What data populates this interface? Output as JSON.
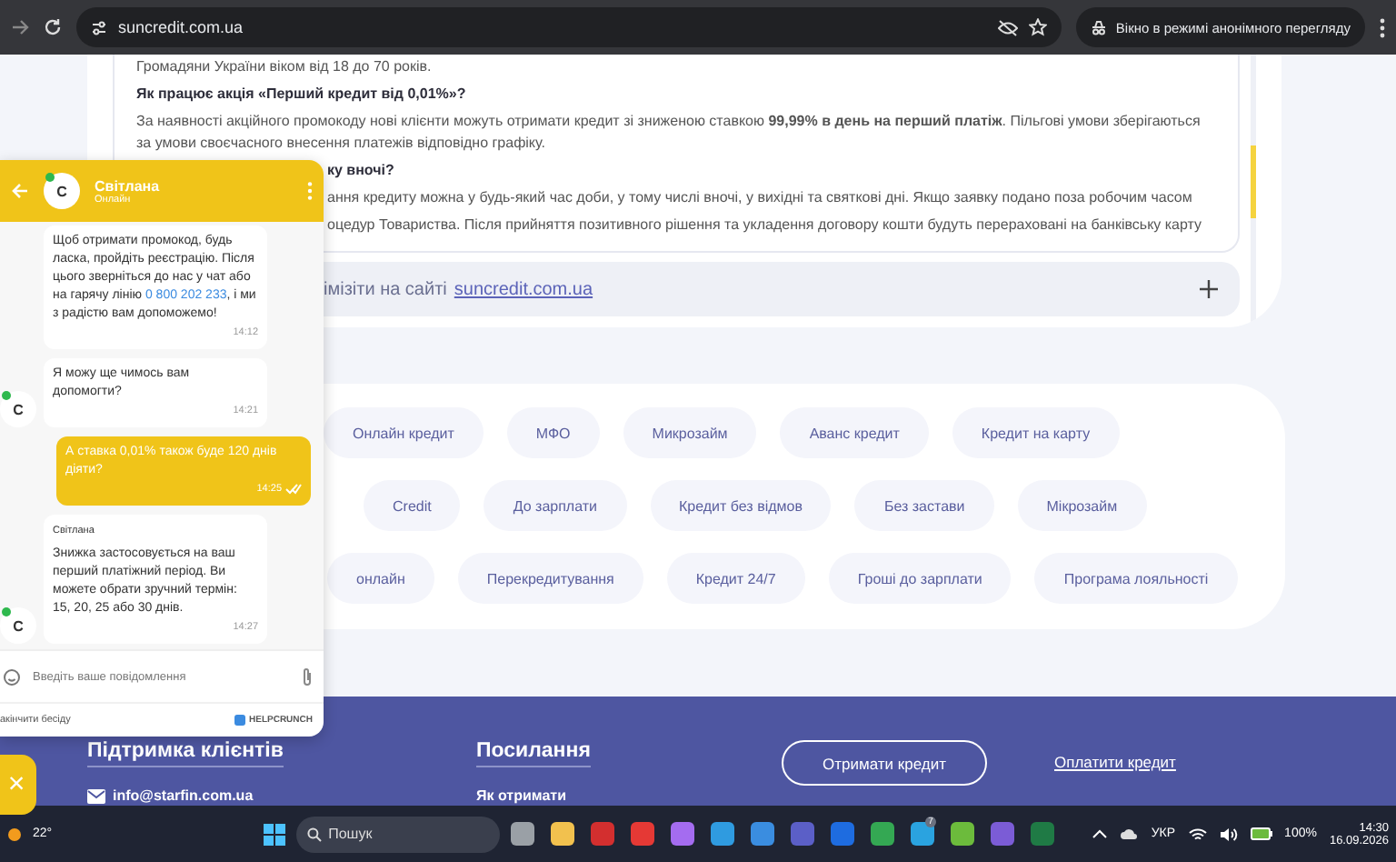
{
  "browser": {
    "url": "suncredit.com.ua",
    "incognito_label": "Вікно в режимі анонімного перегляду"
  },
  "faq": {
    "blocks": [
      {
        "kind": "text",
        "text": "Громадяни України віком від 18 до 70 років."
      },
      {
        "kind": "question",
        "text": "Як працює акція «Перший кредит від 0,01%»?"
      },
      {
        "kind": "text",
        "text": "За наявності акційного промокоду нові клієнти можуть отримати кредит зі зниженою ставкою **99,99% в день на перший платіж**. Пільгові умови зберігаються за умови своєчасного внесення платежів відповідно графіку."
      },
      {
        "kind": "question_fragment",
        "text": "ку вночі?"
      },
      {
        "kind": "text_fragment",
        "text": "ання кредиту можна у будь-який час доби, у тому числі вночі, у вихідні та святкові дні. Якщо заявку подано поза робочим часом"
      },
      {
        "kind": "text_fragment",
        "text": "оцедур Товариства. Після прийняття позитивного рішення та укладення договору кошти будуть перераховані на банківську карту"
      }
    ],
    "collapsed": {
      "text": "імізіти на сайті",
      "link": "suncredit.com.ua"
    }
  },
  "chat": {
    "agent_name": "Світлана",
    "status": "Онлайн",
    "avatar_letter": "С",
    "messages": [
      {
        "kind": "agent",
        "text": "Щоб отримати промокод, будь ласка, пройдіть реєстрацію. Після цього зверніться до нас у чат або на гарячу лінію",
        "link": "0 800 202 233",
        "text_after": ", і ми з радістю вам допоможемо!",
        "time": "14:12"
      },
      {
        "kind": "agent",
        "text": "Я можу ще чимось вам допомогти?",
        "time": "14:21",
        "avatar_letter": "С"
      },
      {
        "kind": "user",
        "text": "А ставка 0,01% також буде 120 днів діяти?",
        "time": "14:25",
        "read": true
      },
      {
        "kind": "agent",
        "sender": "Світлана",
        "text": "Знижка застосовується на ваш перший платіжний період. Ви можете обрати зручний термін: 15, 20, 25 або 30 днів.",
        "time": "14:27",
        "avatar_letter": "С"
      }
    ],
    "input_placeholder": "Введіть ваше повідомлення",
    "end_label": "акінчити бесіду",
    "brand": "HELPCRUNCH",
    "close_label": "×"
  },
  "chips": [
    [
      "Онлайн кредит",
      "МФО",
      "Микрозайм",
      "Аванс кредит",
      "Кредит на карту"
    ],
    [
      "Credit",
      "До зарплати",
      "Кредит без відмов",
      "Без застави",
      "Мікрозайм"
    ],
    [
      "онлайн",
      "Перекредитування",
      "Кредит 24/7",
      "Гроші до зарплати",
      "Програма лояльності"
    ]
  ],
  "footer": {
    "support_title": "Підтримка клієнтів",
    "email": "info@starfin.com.ua",
    "links_title": "Посилання",
    "links": [
      "Як отримати"
    ],
    "cta_button": "Отримати кредит",
    "pay_link": "Оплатити кредит"
  },
  "taskbar": {
    "weather": "22°",
    "search_placeholder": "Пошук",
    "badge": "7",
    "language": "УКР",
    "battery": "100%",
    "time": "14:30",
    "date": "16.09.2026"
  }
}
